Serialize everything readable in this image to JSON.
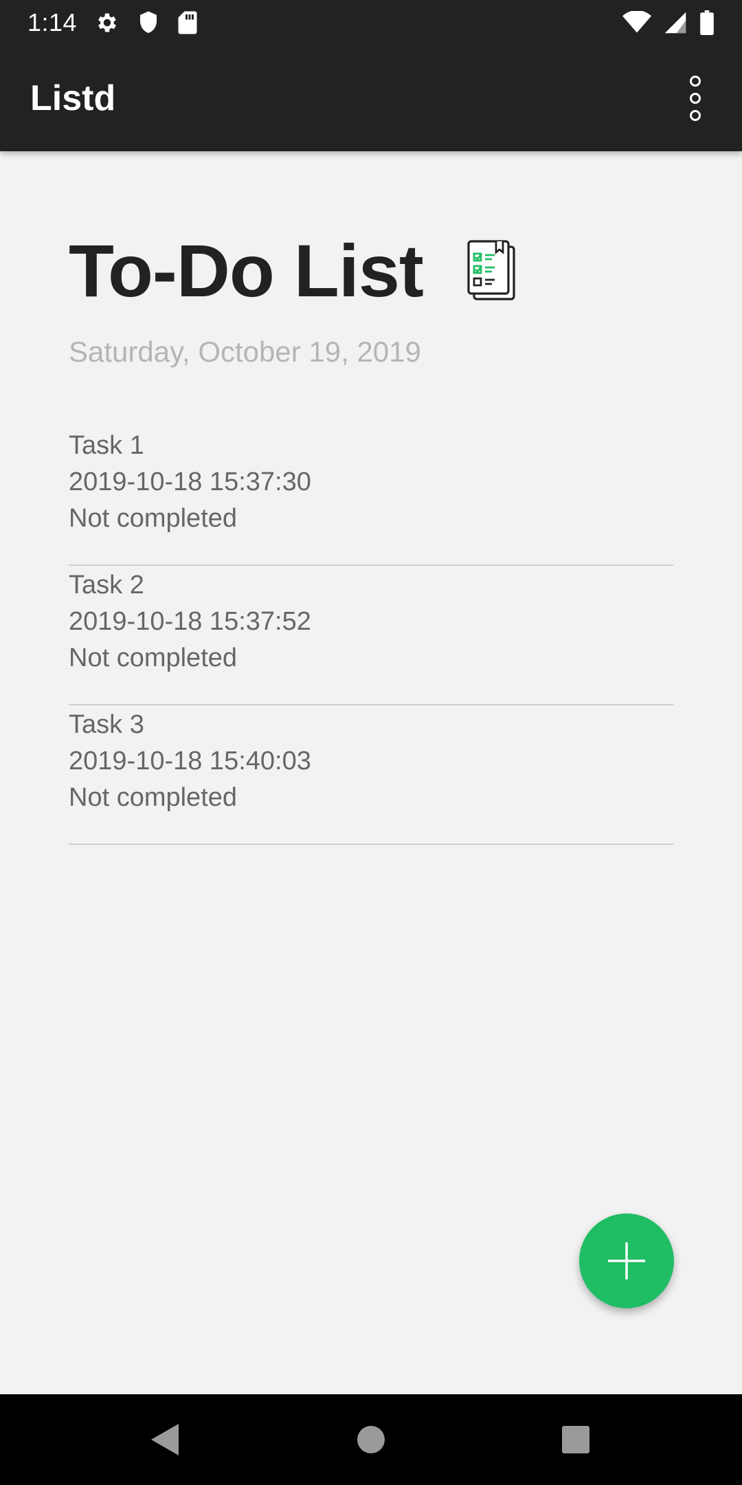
{
  "status_bar": {
    "time": "1:14",
    "left_icons": [
      "gear-icon",
      "shield-icon",
      "sd-card-icon"
    ],
    "right_icons": [
      "wifi-icon",
      "signal-icon",
      "battery-icon"
    ]
  },
  "app_bar": {
    "title": "Listd",
    "overflow_icon": "more-vert-icon"
  },
  "header": {
    "title": "To-Do List",
    "icon": "checklist-icon",
    "date": "Saturday, October 19, 2019"
  },
  "tasks": [
    {
      "name": "Task 1",
      "timestamp": "2019-10-18 15:37:30",
      "status": "Not completed"
    },
    {
      "name": "Task 2",
      "timestamp": "2019-10-18 15:37:52",
      "status": "Not completed"
    },
    {
      "name": "Task 3",
      "timestamp": "2019-10-18 15:40:03",
      "status": "Not completed"
    }
  ],
  "fab": {
    "icon": "plus-icon"
  },
  "nav_bar": {
    "icons": [
      "back-icon",
      "home-icon",
      "recents-icon"
    ]
  },
  "colors": {
    "bar_background": "#222222",
    "page_background": "#f2f2f2",
    "accent_green": "#1fbd64",
    "title_text": "#222222",
    "date_text": "#b5b5b5",
    "task_text": "#666666"
  }
}
